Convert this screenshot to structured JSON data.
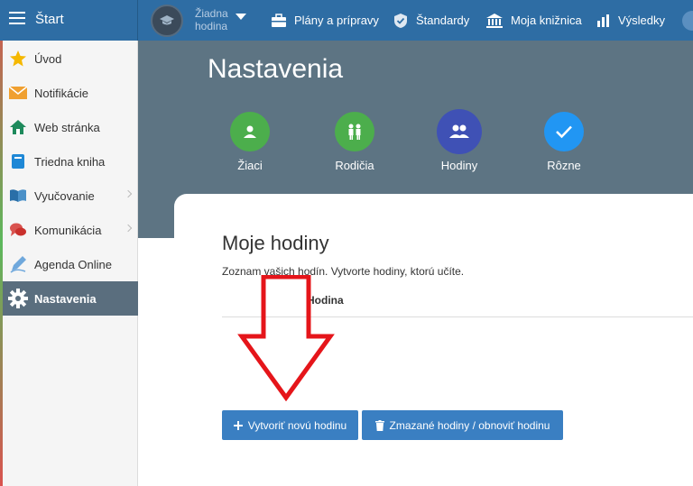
{
  "topbar": {
    "start_label": "Štart",
    "class_selector": {
      "line1": "Žiadna",
      "line2": "hodina"
    },
    "nav": [
      {
        "label": "Plány a prípravy",
        "icon": "briefcase-icon"
      },
      {
        "label": "Štandardy",
        "icon": "shield-check-icon"
      },
      {
        "label": "Moja knižnica",
        "icon": "library-icon"
      },
      {
        "label": "Výsledky",
        "icon": "bar-chart-icon"
      }
    ]
  },
  "sidebar": {
    "items": [
      {
        "label": "Úvod",
        "icon": "star-icon"
      },
      {
        "label": "Notifikácie",
        "icon": "envelope-icon"
      },
      {
        "label": "Web stránka",
        "icon": "home-icon"
      },
      {
        "label": "Triedna kniha",
        "icon": "book-icon"
      },
      {
        "label": "Vyučovanie",
        "icon": "open-book-icon"
      },
      {
        "label": "Komunikácia",
        "icon": "chat-icon"
      },
      {
        "label": "Agenda Online",
        "icon": "pen-icon"
      },
      {
        "label": "Nastavenia",
        "icon": "gear-icon"
      }
    ]
  },
  "main": {
    "title": "Nastavenia",
    "tabs": [
      {
        "label": "Žiaci",
        "icon": "student-icon",
        "color": "#4cae4c"
      },
      {
        "label": "Rodičia",
        "icon": "parents-icon",
        "color": "#4cae4c"
      },
      {
        "label": "Hodiny",
        "icon": "people-icon",
        "color": "#3f51b5"
      },
      {
        "label": "Rôzne",
        "icon": "check-icon",
        "color": "#2196f3"
      }
    ],
    "card": {
      "title": "Moje hodiny",
      "description": "Zoznam vašich hodín. Vytvorte hodiny, ktorú učíte.",
      "column_header": "Hodina",
      "create_button": "Vytvoriť novú hodinu",
      "deleted_button": "Zmazané hodiny / obnoviť hodinu"
    }
  },
  "colors": {
    "topbar": "#2e6da4",
    "hero": "#5d7483",
    "button": "#3a7fc2",
    "arrow": "#e5151a"
  }
}
